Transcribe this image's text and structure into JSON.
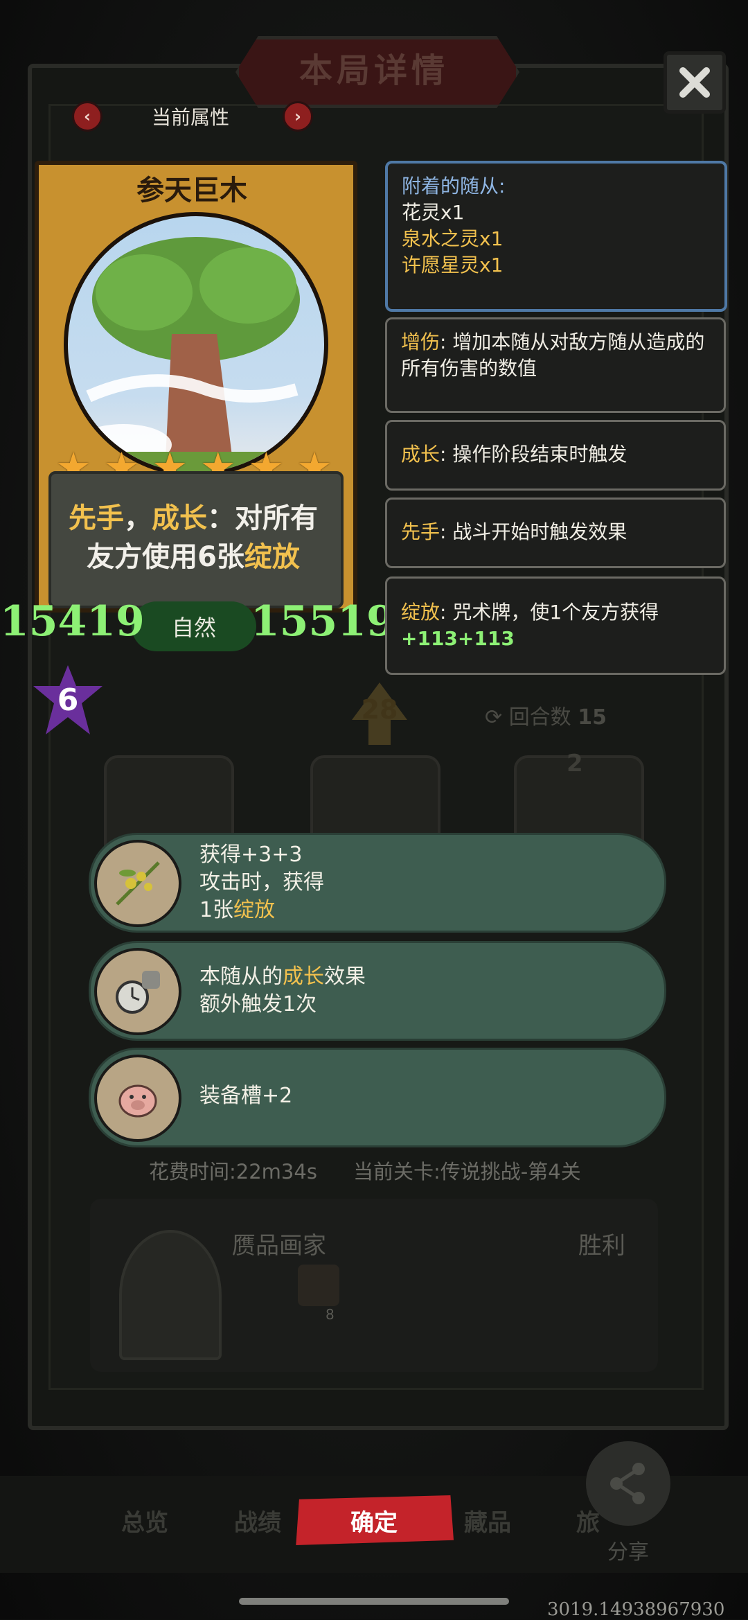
{
  "header": {
    "title": "本局详情",
    "attr_label": "当前属性"
  },
  "card": {
    "name": "参天巨木",
    "stars": 6,
    "desc_first": "先手",
    "desc_sep": "，",
    "desc_growth": "成长",
    "desc_rest1": "：对所有",
    "desc_line2a": "友方使用6张",
    "desc_bloom": "绽放",
    "attack": "15419",
    "health": "15519",
    "type": "自然",
    "level": "6"
  },
  "panels": {
    "attached_title": "附着的随从:",
    "attached_1": "花灵x1",
    "attached_2": "泉水之灵x1",
    "attached_3": "许愿星灵x1",
    "dmg_key": "增伤",
    "dmg_text": ": 增加本随从对敌方随从造成的所有伤害的数值",
    "growth_key": "成长",
    "growth_text": ": 操作阶段结束时触发",
    "first_key": "先手",
    "first_text": ": 战斗开始时触发效果",
    "bloom_key": "绽放",
    "bloom_text": ": 咒术牌，使1个友方获得",
    "bloom_value": "+113+113"
  },
  "middle": {
    "center_number": "28",
    "round_label": "回合数",
    "round_value": "15",
    "slot_badge": "2"
  },
  "rewards": [
    {
      "line1": "获得+3+3",
      "line2": "攻击时，获得",
      "line3a": "1张",
      "line3b": "绽放",
      "icon": "herb-icon"
    },
    {
      "line1a": "本随从的",
      "line1b": "成长",
      "line1c": "效果",
      "line2": "额外触发1次",
      "icon": "pocket-watch-icon"
    },
    {
      "line1": "装备槽+2",
      "icon": "pig-icon"
    }
  ],
  "lower": {
    "time_label": "花费时间:",
    "time_value": "22m34s",
    "stage_label": "当前关卡:",
    "stage_value": "传说挑战-第4关",
    "player_name": "赝品画家",
    "result": "胜利",
    "item_count": "8"
  },
  "nav": {
    "overview": "总览",
    "battle": "战绩",
    "confirm": "确定",
    "collection": "藏品",
    "other": "旅",
    "share": "分享"
  },
  "build": "3019.14938967930",
  "colors": {
    "accent_red": "#c4232a",
    "stat_green": "#8df075",
    "keyword_yellow": "#f2c14e",
    "reward_teal": "#3e5d50",
    "attached_blue": "#8fb6e4"
  }
}
